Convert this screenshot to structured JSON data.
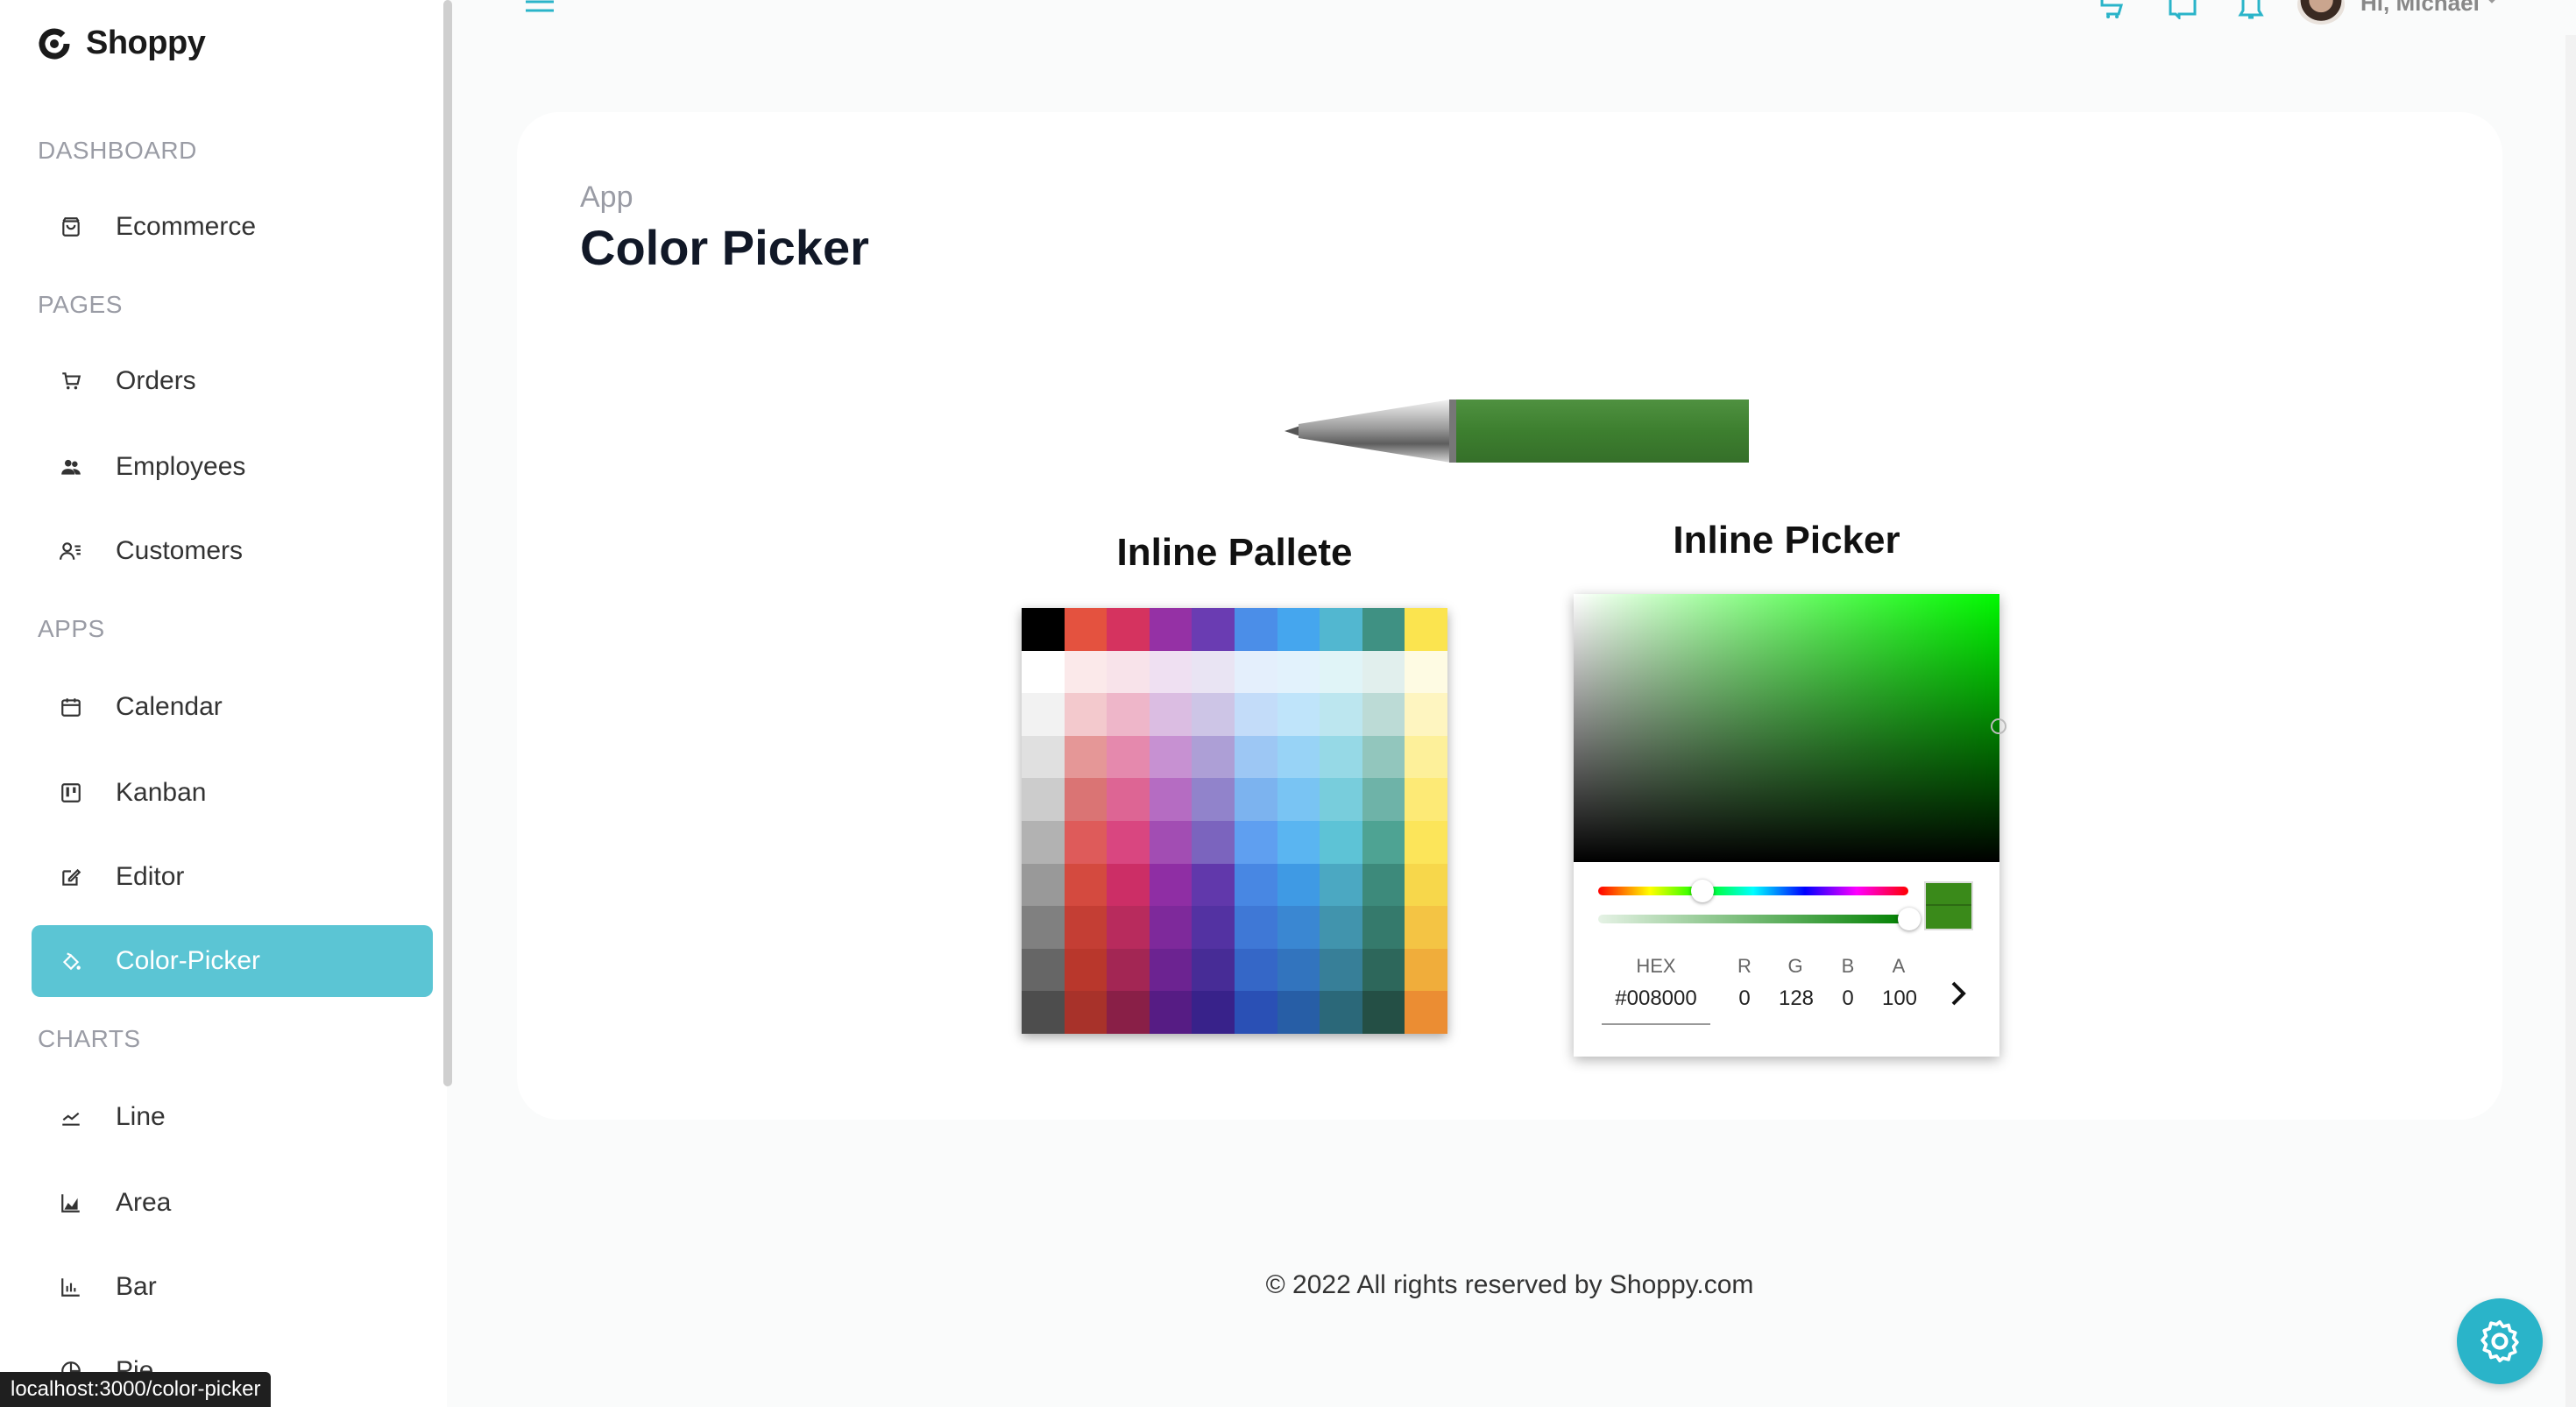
{
  "app": {
    "name": "Shoppy"
  },
  "sidebar": {
    "sections": [
      {
        "title": "DASHBOARD"
      },
      {
        "title": "PAGES"
      },
      {
        "title": "APPS"
      },
      {
        "title": "CHARTS"
      }
    ],
    "items": [
      {
        "label": "Ecommerce",
        "icon": "bag-icon"
      },
      {
        "label": "Orders",
        "icon": "cart-icon"
      },
      {
        "label": "Employees",
        "icon": "people-icon"
      },
      {
        "label": "Customers",
        "icon": "contact-icon"
      },
      {
        "label": "Calendar",
        "icon": "calendar-icon"
      },
      {
        "label": "Kanban",
        "icon": "kanban-icon"
      },
      {
        "label": "Editor",
        "icon": "edit-icon"
      },
      {
        "label": "Color-Picker",
        "icon": "color-fill-icon",
        "active": true
      },
      {
        "label": "Line",
        "icon": "line-chart-icon"
      },
      {
        "label": "Area",
        "icon": "area-chart-icon"
      },
      {
        "label": "Bar",
        "icon": "bar-chart-icon"
      },
      {
        "label": "Pie",
        "icon": "pie-chart-icon"
      }
    ]
  },
  "topbar": {
    "greeting": "Hi, Michael"
  },
  "main": {
    "breadcrumb": "App",
    "title": "Color Picker",
    "palette_title": "Inline Pallete",
    "picker_title": "Inline Picker",
    "palette_colors": [
      [
        "#000000",
        "#e4523f",
        "#d5335f",
        "#9531a5",
        "#6a3cb2",
        "#4b8ee8",
        "#45a6ee",
        "#52b7d0",
        "#3f9183",
        "#fbe44f"
      ],
      [
        "#ffffff",
        "#fbe9ea",
        "#f8e3ea",
        "#efe0f2",
        "#e9e4f3",
        "#e4effc",
        "#e2f2fc",
        "#e0f4f7",
        "#e1efed",
        "#fefbe3"
      ],
      [
        "#f2f2f2",
        "#f3c9cd",
        "#eeb6c9",
        "#dbbde2",
        "#cdc5e6",
        "#c3dcf9",
        "#bfe4fa",
        "#bce6ef",
        "#bcdbd6",
        "#fef5c0"
      ],
      [
        "#e0e0e0",
        "#e59797",
        "#e589ad",
        "#c791d2",
        "#ad9fd6",
        "#9dc7f4",
        "#98d3f6",
        "#96d9e6",
        "#92c6bd",
        "#fdf09a"
      ],
      [
        "#cccccc",
        "#da7474",
        "#dd6594",
        "#b56cc2",
        "#9183cb",
        "#7cb3ef",
        "#79c4f3",
        "#78cddc",
        "#6eb3a8",
        "#fdea76"
      ],
      [
        "#b2b2b2",
        "#de5b5a",
        "#d94680",
        "#a24db3",
        "#7b64be",
        "#5f9ff0",
        "#5ab5f1",
        "#5dc3d6",
        "#4ea393",
        "#fce55a"
      ],
      [
        "#999999",
        "#d44a3f",
        "#cc2e66",
        "#8f2ea4",
        "#6138ab",
        "#4887e3",
        "#3f9ae4",
        "#4ba8c2",
        "#3d8a7b",
        "#f7d74b"
      ],
      [
        "#808080",
        "#c43e34",
        "#b82b5d",
        "#7e299b",
        "#5332a2",
        "#3f78d6",
        "#3a87d2",
        "#4194ad",
        "#357a6c",
        "#f4c444"
      ],
      [
        "#666666",
        "#b9372c",
        "#a32654",
        "#6c2391",
        "#472c96",
        "#3567c7",
        "#3274be",
        "#377f98",
        "#2d675b",
        "#f0ad3b"
      ],
      [
        "#4d4d4d",
        "#a8322a",
        "#891f47",
        "#561c84",
        "#38228a",
        "#2a50b5",
        "#275ea6",
        "#2b6879",
        "#244f45",
        "#eb8d33"
      ]
    ],
    "picker": {
      "hex_label": "HEX",
      "hex_value": "#008000",
      "r_label": "R",
      "r_value": "0",
      "g_label": "G",
      "g_value": "128",
      "b_label": "B",
      "b_value": "0",
      "a_label": "A",
      "a_value": "100",
      "selected_color": "#008000"
    }
  },
  "footer": {
    "text": "© 2022 All rights reserved by Shoppy.com"
  },
  "status_bar": {
    "url": "localhost:3000/color-picker"
  },
  "colors": {
    "accent": "#5bc5d4",
    "settings": "#2ab4c9",
    "pen_body": "#3d7f2f"
  }
}
